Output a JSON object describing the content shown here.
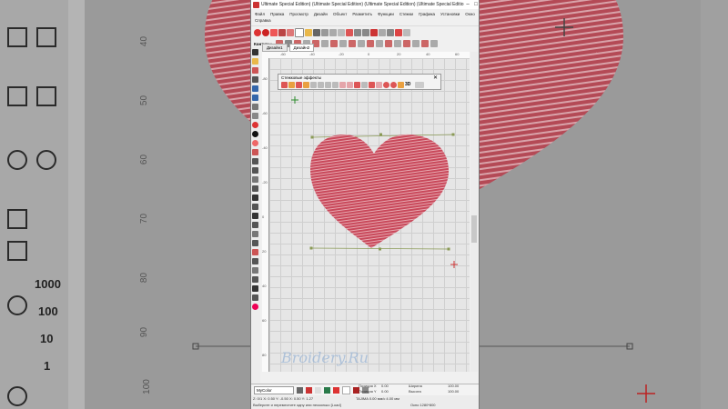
{
  "window": {
    "title": "Ultimate Special Edition) (Ultimate Special Edition) (Ultimate Special Edition) (Ultimate Special Editio",
    "controls": [
      "–",
      "□",
      "✕"
    ]
  },
  "menu": {
    "items": [
      "Файл",
      "Правка",
      "Просмотр",
      "Дизайн",
      "Объект",
      "Разметить",
      "Функции",
      "Стежки",
      "Графика",
      "Установки",
      "Окно"
    ],
    "second_row": "Справка"
  },
  "contours_toolbar": {
    "label": "Контуры"
  },
  "tabs": [
    {
      "label": "Дизайн1",
      "active": false
    },
    {
      "label": "Дизайн2",
      "active": true
    }
  ],
  "ruler": {
    "top_ticks": [
      "-60",
      "-40",
      "-20",
      "0",
      "20",
      "40",
      "60"
    ],
    "left_ticks": [
      "-80",
      "-60",
      "-40",
      "-20",
      "0",
      "20",
      "40",
      "60",
      "80"
    ]
  },
  "effects_panel": {
    "title": "Стежковые эффекты",
    "close": "✕",
    "label_3d": "3D"
  },
  "background_ruler": [
    "40",
    "50",
    "60",
    "70",
    "80",
    "90",
    "100"
  ],
  "background_numbers": [
    "1000",
    "100",
    "10",
    "1"
  ],
  "watermark": "Broidery.Ru",
  "color_bar": {
    "selector": "MyColor"
  },
  "position_panel": {
    "pos_x_label": "Позиция X",
    "pos_x": "0.00",
    "pos_y_label": "Позиция Y",
    "pos_y": "0.00",
    "width_label": "Ширина",
    "width": "100.00",
    "height_label": "Высота",
    "height": "100.00"
  },
  "status": {
    "line1": "Z: 0/1    X: 0.50 Y: -0.50 X: 0.50 Y: 1.27",
    "line1_right": "TAJIMA  0.00 мм/с  4.00 мм",
    "line2": "Выберите и переместите одну или несколько [Load]",
    "line2_right": "Окно 1280*800"
  },
  "colors": {
    "heart": "#c8485a",
    "canvas": "#e6e6e6",
    "guide_line": "#8a9a55"
  }
}
